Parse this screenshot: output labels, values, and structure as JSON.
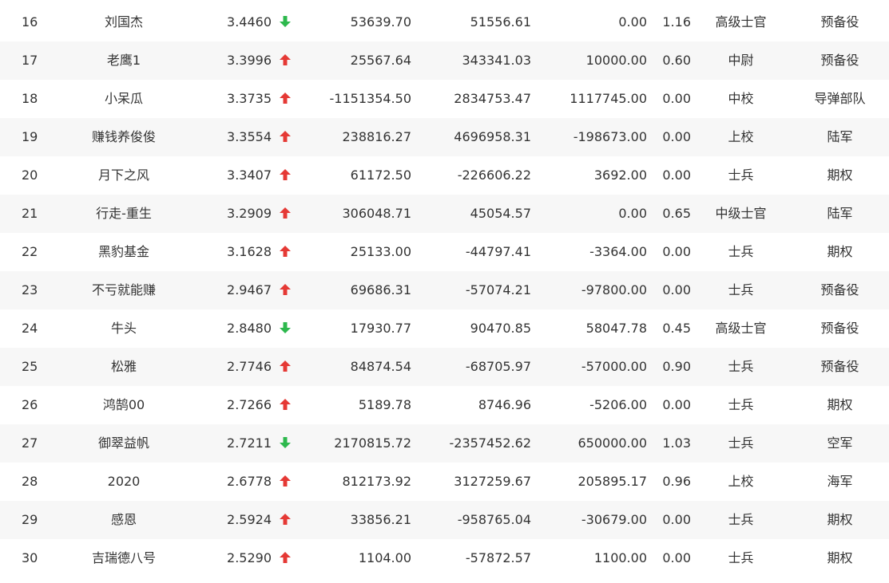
{
  "colors": {
    "up": "#e53935",
    "down": "#2db84d",
    "text": "#333333",
    "stripe": "#f7f7f7"
  },
  "rows": [
    {
      "rank": "16",
      "name": "刘国杰",
      "ratio": "3.4460",
      "trend": "down",
      "c1": "53639.70",
      "c2": "51556.61",
      "c3": "0.00",
      "lev": "1.16",
      "title": "高级士官",
      "cat": "预备役"
    },
    {
      "rank": "17",
      "name": "老鹰1",
      "ratio": "3.3996",
      "trend": "up",
      "c1": "25567.64",
      "c2": "343341.03",
      "c3": "10000.00",
      "lev": "0.60",
      "title": "中尉",
      "cat": "预备役"
    },
    {
      "rank": "18",
      "name": "小呆瓜",
      "ratio": "3.3735",
      "trend": "up",
      "c1": "-1151354.50",
      "c2": "2834753.47",
      "c3": "1117745.00",
      "lev": "0.00",
      "title": "中校",
      "cat": "导弹部队"
    },
    {
      "rank": "19",
      "name": "赚钱养俊俊",
      "ratio": "3.3554",
      "trend": "up",
      "c1": "238816.27",
      "c2": "4696958.31",
      "c3": "-198673.00",
      "lev": "0.00",
      "title": "上校",
      "cat": "陆军"
    },
    {
      "rank": "20",
      "name": "月下之风",
      "ratio": "3.3407",
      "trend": "up",
      "c1": "61172.50",
      "c2": "-226606.22",
      "c3": "3692.00",
      "lev": "0.00",
      "title": "士兵",
      "cat": "期权"
    },
    {
      "rank": "21",
      "name": "行走-重生",
      "ratio": "3.2909",
      "trend": "up",
      "c1": "306048.71",
      "c2": "45054.57",
      "c3": "0.00",
      "lev": "0.65",
      "title": "中级士官",
      "cat": "陆军"
    },
    {
      "rank": "22",
      "name": "黑豹基金",
      "ratio": "3.1628",
      "trend": "up",
      "c1": "25133.00",
      "c2": "-44797.41",
      "c3": "-3364.00",
      "lev": "0.00",
      "title": "士兵",
      "cat": "期权"
    },
    {
      "rank": "23",
      "name": "不亏就能赚",
      "ratio": "2.9467",
      "trend": "up",
      "c1": "69686.31",
      "c2": "-57074.21",
      "c3": "-97800.00",
      "lev": "0.00",
      "title": "士兵",
      "cat": "预备役"
    },
    {
      "rank": "24",
      "name": "牛头",
      "ratio": "2.8480",
      "trend": "down",
      "c1": "17930.77",
      "c2": "90470.85",
      "c3": "58047.78",
      "lev": "0.45",
      "title": "高级士官",
      "cat": "预备役"
    },
    {
      "rank": "25",
      "name": "松雅",
      "ratio": "2.7746",
      "trend": "up",
      "c1": "84874.54",
      "c2": "-68705.97",
      "c3": "-57000.00",
      "lev": "0.90",
      "title": "士兵",
      "cat": "预备役"
    },
    {
      "rank": "26",
      "name": "鸿鹄00",
      "ratio": "2.7266",
      "trend": "up",
      "c1": "5189.78",
      "c2": "8746.96",
      "c3": "-5206.00",
      "lev": "0.00",
      "title": "士兵",
      "cat": "期权"
    },
    {
      "rank": "27",
      "name": "御翠益帆",
      "ratio": "2.7211",
      "trend": "down",
      "c1": "2170815.72",
      "c2": "-2357452.62",
      "c3": "650000.00",
      "lev": "1.03",
      "title": "士兵",
      "cat": "空军"
    },
    {
      "rank": "28",
      "name": "2020",
      "ratio": "2.6778",
      "trend": "up",
      "c1": "812173.92",
      "c2": "3127259.67",
      "c3": "205895.17",
      "lev": "0.96",
      "title": "上校",
      "cat": "海军"
    },
    {
      "rank": "29",
      "name": "感恩",
      "ratio": "2.5924",
      "trend": "up",
      "c1": "33856.21",
      "c2": "-958765.04",
      "c3": "-30679.00",
      "lev": "0.00",
      "title": "士兵",
      "cat": "期权"
    },
    {
      "rank": "30",
      "name": "吉瑞德八号",
      "ratio": "2.5290",
      "trend": "up",
      "c1": "1104.00",
      "c2": "-57872.57",
      "c3": "1100.00",
      "lev": "0.00",
      "title": "士兵",
      "cat": "期权"
    }
  ]
}
